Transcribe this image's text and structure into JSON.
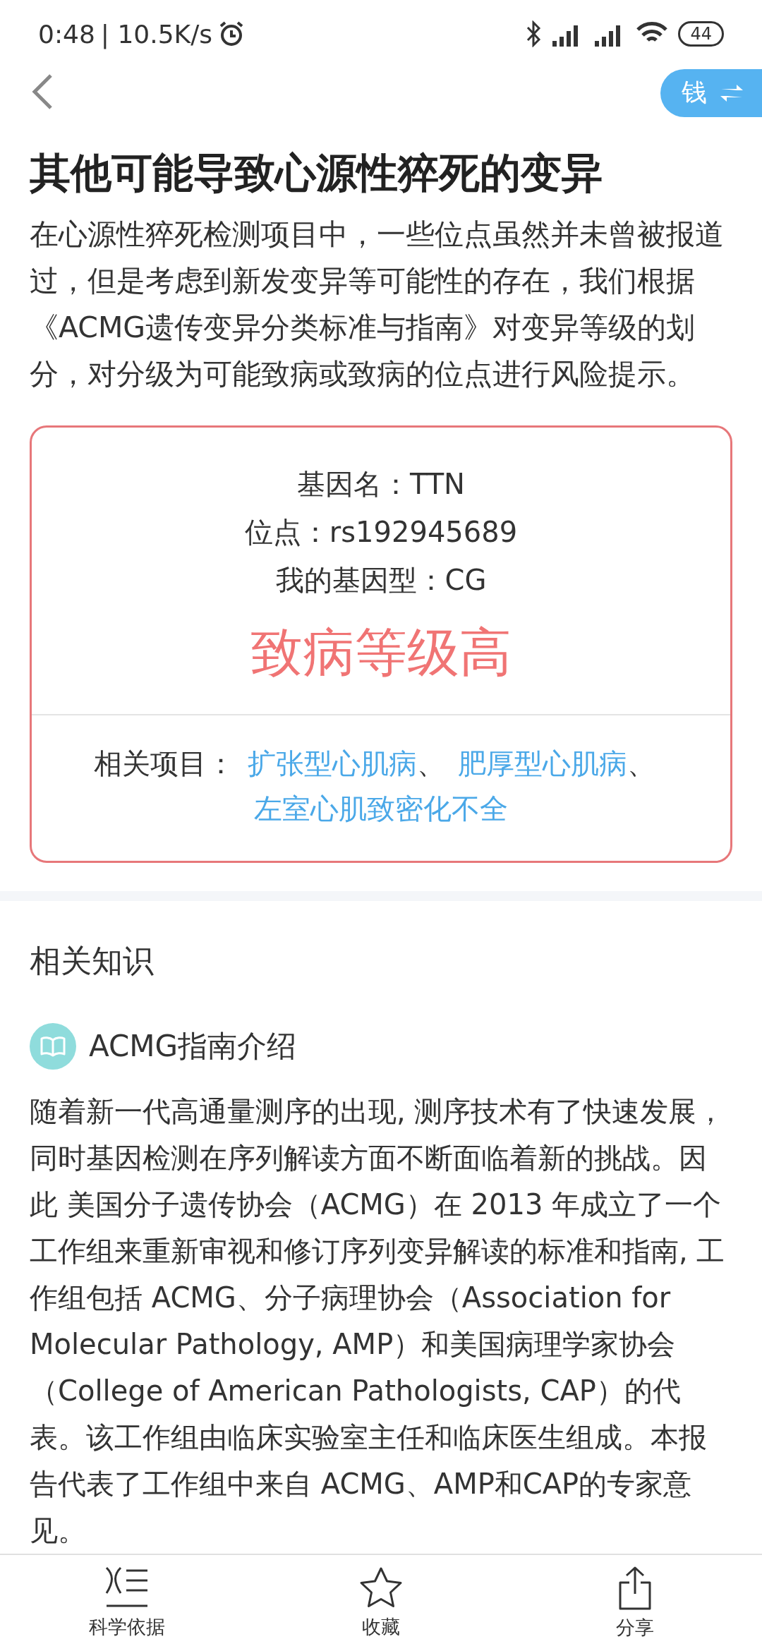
{
  "status_bar": {
    "time": "0:48",
    "speed": "| 10.5K/s",
    "battery": "44"
  },
  "header": {
    "coin_button": "钱"
  },
  "title": "其他可能导致心源性猝死的变异",
  "intro": "在心源性猝死检测项目中，一些位点虽然并未曾被报道过，但是考虑到新发变异等可能性的存在，我们根据《ACMG遗传变异分类标准与指南》对变异等级的划分，对分级为可能致病或致病的位点进行风险提示。",
  "card": {
    "lines": [
      "基因名：TTN",
      "位点：rs192945689",
      "我的基因型：CG"
    ],
    "level": "致病等级高",
    "related_label": "相关项目：",
    "related": [
      {
        "label": "扩张型心肌病",
        "sep": "、"
      },
      {
        "label": "肥厚型心肌病",
        "sep": "、"
      },
      {
        "label": "左室心肌致密化不全"
      }
    ]
  },
  "knowledge": {
    "heading": "相关知识",
    "article_title": "ACMG指南介绍",
    "body": "随着新一代高通量测序的出现, 测序技术有了快速发展，同时基因检测在序列解读方面不断面临着新的挑战。因此 美国分子遗传协会（ACMG）在 2013 年成立了一个工作组来重新审视和修订序列变异解读的标准和指南, 工作组包括 ACMG、分子病理协会（Association for Molecular Pathology, AMP）和美国病理学家协会（College of American Pathologists, CAP）的代表。该工作组由临床实验室主任和临床医生组成。本报告代表了工作组中来自 ACMG、AMP和CAP的专家意见。"
  },
  "bottom_nav": [
    {
      "kind": "evidence",
      "label": "科学依据"
    },
    {
      "kind": "favorite",
      "label": "收藏"
    },
    {
      "kind": "share",
      "label": "分享"
    }
  ]
}
